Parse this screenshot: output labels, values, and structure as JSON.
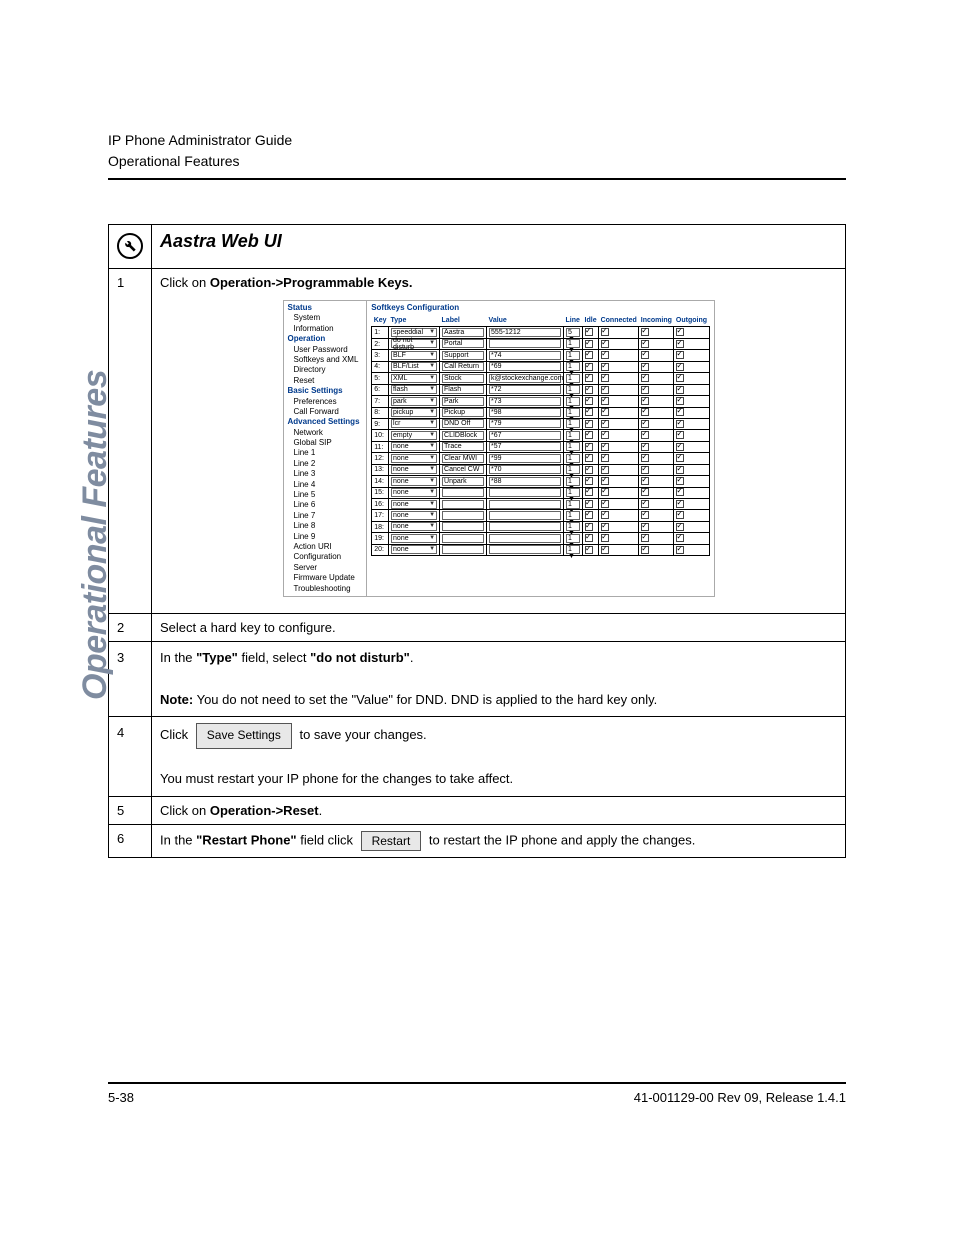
{
  "header": {
    "line1": "IP Phone Administrator Guide",
    "line2": "Operational Features"
  },
  "sidebar_label": "Operational Features",
  "table_title": "Aastra Web UI",
  "steps": {
    "s1_pre": "Click on ",
    "s1_bold": "Operation->Programmable Keys.",
    "s2": "Select a hard key to configure.",
    "s3_p1a": "In the ",
    "s3_p1b": "\"Type\"",
    "s3_p1c": " field, select ",
    "s3_p1d": "\"do not disturb\"",
    "s3_p1e": ".",
    "s3_note_b": "Note:",
    "s3_note_t": " You do not need to set the \"Value\" for DND. DND is applied to the hard key only.",
    "s4_a": "Click",
    "s4_btn": "Save Settings",
    "s4_b": "to save your changes.",
    "s4_c": "You must restart your IP phone for the changes to take affect.",
    "s5_a": "Click on ",
    "s5_b": "Operation->Reset",
    "s5_c": ".",
    "s6_a": "In the ",
    "s6_b": "\"Restart Phone\"",
    "s6_c": " field click",
    "s6_btn": "Restart",
    "s6_d": "to restart the IP phone and apply the changes."
  },
  "mini": {
    "side": {
      "status": "Status",
      "sysinfo": "System Information",
      "operation": "Operation",
      "items_op": [
        "User Password",
        "Softkeys and XML",
        "Directory",
        "Reset"
      ],
      "basic": "Basic Settings",
      "items_basic": [
        "Preferences",
        "Call Forward"
      ],
      "advanced": "Advanced Settings",
      "items_adv": [
        "Network",
        "Global SIP",
        "Line 1",
        "Line 2",
        "Line 3",
        "Line 4",
        "Line 5",
        "Line 6",
        "Line 7",
        "Line 8",
        "Line 9",
        "Action URI",
        "Configuration Server",
        "Firmware Update",
        "Troubleshooting"
      ]
    },
    "content_title": "Softkeys Configuration",
    "cols": [
      "Key",
      "Type",
      "Label",
      "Value",
      "Line",
      "Idle",
      "Connected",
      "Incoming",
      "Outgoing"
    ],
    "rows": [
      {
        "k": 1,
        "type": "speeddial",
        "label": "Aastra",
        "value": "555-1212",
        "line": "5",
        "chk": [
          1,
          1,
          1,
          1
        ]
      },
      {
        "k": 2,
        "type": "do not disturb",
        "label": "Portal",
        "value": "",
        "line": "1",
        "chk": [
          1,
          1,
          1,
          1
        ]
      },
      {
        "k": 3,
        "type": "BLF",
        "label": "Support",
        "value": "*74",
        "line": "1",
        "chk": [
          1,
          1,
          1,
          1
        ]
      },
      {
        "k": 4,
        "type": "BLF/List",
        "label": "Call Return",
        "value": "*69",
        "line": "1",
        "chk": [
          1,
          1,
          1,
          1
        ]
      },
      {
        "k": 5,
        "type": "XML",
        "label": "Stock",
        "value": "k@stockexchange.com",
        "line": "1",
        "chk": [
          1,
          1,
          1,
          1
        ]
      },
      {
        "k": 6,
        "type": "flash",
        "label": "Flash",
        "value": "*72",
        "line": "1",
        "chk": [
          1,
          1,
          1,
          1
        ]
      },
      {
        "k": 7,
        "type": "park",
        "label": "Park",
        "value": "*73",
        "line": "1",
        "chk": [
          1,
          1,
          1,
          1
        ]
      },
      {
        "k": 8,
        "type": "pickup",
        "label": "Pickup",
        "value": "*98",
        "line": "1",
        "chk": [
          1,
          1,
          1,
          1
        ]
      },
      {
        "k": 9,
        "type": "lcr",
        "label": "DND Off",
        "value": "*79",
        "line": "1",
        "chk": [
          1,
          1,
          1,
          1
        ]
      },
      {
        "k": 10,
        "type": "empty",
        "label": "CLIDBlock",
        "value": "*67",
        "line": "1",
        "chk": [
          1,
          1,
          1,
          1
        ]
      },
      {
        "k": 11,
        "type": "none",
        "label": "Trace",
        "value": "*57",
        "line": "1",
        "chk": [
          1,
          1,
          1,
          1
        ]
      },
      {
        "k": 12,
        "type": "none",
        "label": "Clear MWI",
        "value": "*99",
        "line": "1",
        "chk": [
          1,
          1,
          1,
          1
        ]
      },
      {
        "k": 13,
        "type": "none",
        "label": "Cancel CW",
        "value": "*70",
        "line": "1",
        "chk": [
          1,
          1,
          1,
          1
        ]
      },
      {
        "k": 14,
        "type": "none",
        "label": "Unpark",
        "value": "*88",
        "line": "1",
        "chk": [
          1,
          1,
          1,
          1
        ]
      },
      {
        "k": 15,
        "type": "none",
        "label": "",
        "value": "",
        "line": "1",
        "chk": [
          1,
          1,
          1,
          1
        ]
      },
      {
        "k": 16,
        "type": "none",
        "label": "",
        "value": "",
        "line": "1",
        "chk": [
          1,
          1,
          1,
          1
        ]
      },
      {
        "k": 17,
        "type": "none",
        "label": "",
        "value": "",
        "line": "1",
        "chk": [
          1,
          1,
          1,
          1
        ]
      },
      {
        "k": 18,
        "type": "none",
        "label": "",
        "value": "",
        "line": "1",
        "chk": [
          1,
          1,
          1,
          1
        ]
      },
      {
        "k": 19,
        "type": "none",
        "label": "",
        "value": "",
        "line": "1",
        "chk": [
          1,
          1,
          1,
          1
        ]
      },
      {
        "k": 20,
        "type": "none",
        "label": "",
        "value": "",
        "line": "1",
        "chk": [
          1,
          1,
          1,
          1
        ]
      }
    ]
  },
  "footer": {
    "left": "5-38",
    "right": "41-001129-00 Rev 09, Release 1.4.1"
  }
}
